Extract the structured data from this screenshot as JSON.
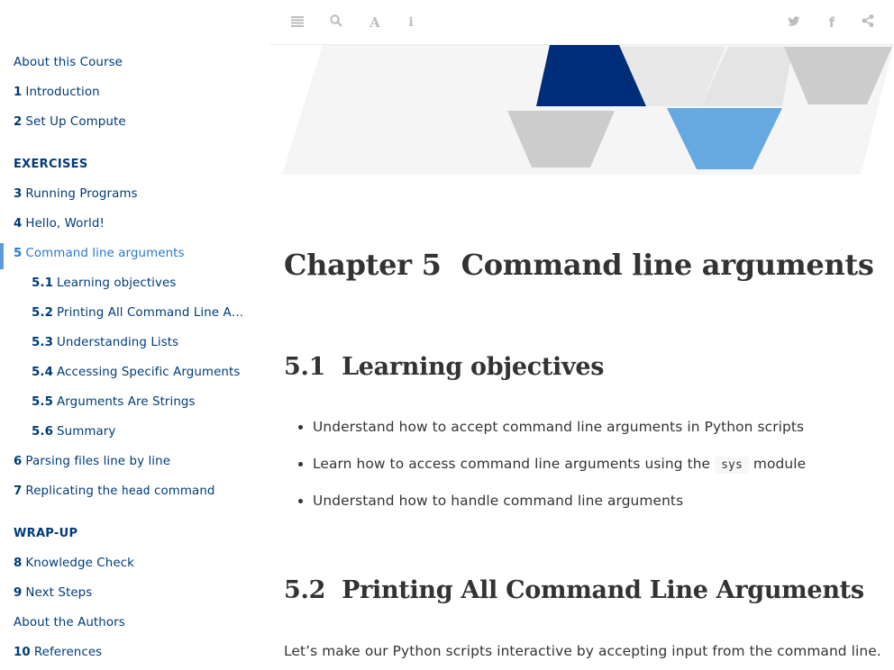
{
  "toolbar": {
    "icons": [
      "menu-icon",
      "search-icon",
      "font-icon",
      "info-icon",
      "twitter-icon",
      "facebook-icon",
      "share-icon"
    ]
  },
  "sidebar": {
    "items": [
      {
        "num": "",
        "label": "About this Course"
      },
      {
        "num": "1",
        "label": "Introduction"
      },
      {
        "num": "2",
        "label": "Set Up Compute"
      }
    ],
    "exercises_header": "EXERCISES",
    "exercises": [
      {
        "num": "3",
        "label": "Running Programs"
      },
      {
        "num": "4",
        "label": "Hello, World!"
      },
      {
        "num": "5",
        "label": "Command line arguments"
      }
    ],
    "subsections": [
      {
        "num": "5.1",
        "label": "Learning objectives"
      },
      {
        "num": "5.2",
        "label": "Printing All Command Line Argu…"
      },
      {
        "num": "5.3",
        "label": "Understanding Lists"
      },
      {
        "num": "5.4",
        "label": "Accessing Specific Arguments"
      },
      {
        "num": "5.5",
        "label": "Arguments Are Strings"
      },
      {
        "num": "5.6",
        "label": "Summary"
      }
    ],
    "more": [
      {
        "num": "6",
        "label": "Parsing files line by line"
      },
      {
        "num": "7",
        "label_pre": "Replicating the ",
        "label_code": "head",
        "label_post": " command"
      }
    ],
    "wrapup_header": "WRAP-UP",
    "wrapup": [
      {
        "num": "8",
        "label": "Knowledge Check"
      },
      {
        "num": "9",
        "label": "Next Steps"
      },
      {
        "num": "",
        "label": "About the Authors"
      },
      {
        "num": "10",
        "label": "References"
      }
    ]
  },
  "main": {
    "chapter_prefix": "Chapter 5",
    "chapter_title": "Command line arguments",
    "sec1_num": "5.1",
    "sec1_title": "Learning objectives",
    "objectives": [
      {
        "text": "Understand how to accept command line arguments in Python scripts"
      },
      {
        "pre": "Learn how to access command line arguments using the ",
        "code": "sys",
        "post": " module"
      },
      {
        "text": "Understand how to handle command line arguments"
      }
    ],
    "sec2_num": "5.2",
    "sec2_title": "Printing All Command Line Arguments",
    "paragraph": "Let’s make our Python scripts interactive by accepting input from the command line."
  },
  "colors": {
    "link": "#003b7a",
    "active_bar": "#5b9bd8",
    "banner_navy": "#002d7a",
    "banner_blue": "#66a9e0",
    "banner_gray": "#cccccc"
  }
}
